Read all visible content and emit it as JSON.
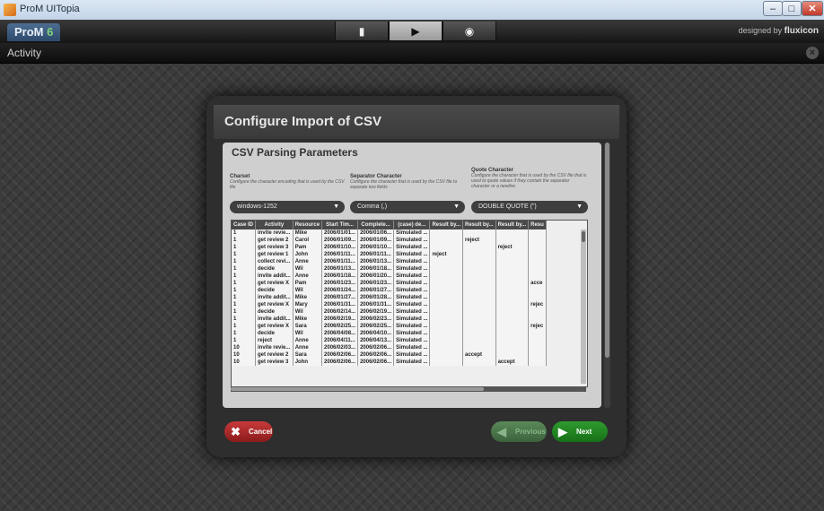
{
  "window": {
    "title": "ProM UITopia"
  },
  "header": {
    "logo_text": "ProM",
    "logo_version": "6",
    "tabs": [
      {
        "icon": "workspace-icon",
        "glyph": "▮"
      },
      {
        "icon": "play-icon",
        "glyph": "▶"
      },
      {
        "icon": "view-icon",
        "glyph": "◉"
      }
    ],
    "brand_prefix": "designed by",
    "brand_name": "fluxicon"
  },
  "activity": {
    "title": "Activity"
  },
  "dialog": {
    "title": "Configure Import of CSV",
    "section_title": "CSV Parsing Parameters",
    "params": {
      "charset": {
        "label": "Charset",
        "description": "Configure the character encoding that is used by the CSV file",
        "value": "windows-1252"
      },
      "separator": {
        "label": "Separator Character",
        "description": "Configure the character that is used by the CSV file to separate two fields",
        "value": "Comma (,)"
      },
      "quote": {
        "label": "Quote Character",
        "description": "Configure the character that is used by the CSV file that is used to quote values if they contain the separator character or a newline",
        "value": "DOUBLE QUOTE (\")"
      }
    },
    "table": {
      "columns": [
        "Case ID",
        "Activity",
        "Resource",
        "Start Tim...",
        "Complete...",
        "(case) de...",
        "Result by...",
        "Result by...",
        "Result by...",
        "Resu"
      ],
      "rows": [
        [
          "1",
          "invite revie...",
          "Mike",
          "2006/01/01...",
          "2006/01/06...",
          "Simulated ...",
          "",
          "",
          "",
          ""
        ],
        [
          "1",
          "get review 2",
          "Carol",
          "2006/01/09...",
          "2006/01/09...",
          "Simulated ...",
          "",
          "reject",
          "",
          ""
        ],
        [
          "1",
          "get review 3",
          "Pam",
          "2006/01/10...",
          "2006/01/10...",
          "Simulated ...",
          "",
          "",
          "reject",
          ""
        ],
        [
          "1",
          "get review 1",
          "John",
          "2006/01/11...",
          "2006/01/11...",
          "Simulated ...",
          "reject",
          "",
          "",
          ""
        ],
        [
          "1",
          "collect revi...",
          "Anne",
          "2006/01/11...",
          "2006/01/13...",
          "Simulated ...",
          "",
          "",
          "",
          ""
        ],
        [
          "1",
          "decide",
          "Wil",
          "2006/01/13...",
          "2006/01/18...",
          "Simulated ...",
          "",
          "",
          "",
          ""
        ],
        [
          "1",
          "invite addit...",
          "Anne",
          "2006/01/18...",
          "2006/01/20...",
          "Simulated ...",
          "",
          "",
          "",
          ""
        ],
        [
          "1",
          "get review X",
          "Pam",
          "2006/01/23...",
          "2006/01/23...",
          "Simulated ...",
          "",
          "",
          "",
          "acce"
        ],
        [
          "1",
          "decide",
          "Wil",
          "2006/01/24...",
          "2006/01/27...",
          "Simulated ...",
          "",
          "",
          "",
          ""
        ],
        [
          "1",
          "invite addit...",
          "Mike",
          "2006/01/27...",
          "2006/01/28...",
          "Simulated ...",
          "",
          "",
          "",
          ""
        ],
        [
          "1",
          "get review X",
          "Mary",
          "2006/01/31...",
          "2006/01/31...",
          "Simulated ...",
          "",
          "",
          "",
          "rejec"
        ],
        [
          "1",
          "decide",
          "Wil",
          "2006/02/14...",
          "2006/02/19...",
          "Simulated ...",
          "",
          "",
          "",
          ""
        ],
        [
          "1",
          "invite addit...",
          "Mike",
          "2006/02/19...",
          "2006/02/23...",
          "Simulated ...",
          "",
          "",
          "",
          ""
        ],
        [
          "1",
          "get review X",
          "Sara",
          "2006/02/25...",
          "2006/02/25...",
          "Simulated ...",
          "",
          "",
          "",
          "rejec"
        ],
        [
          "1",
          "decide",
          "Wil",
          "2006/04/08...",
          "2006/04/10...",
          "Simulated ...",
          "",
          "",
          "",
          ""
        ],
        [
          "1",
          "reject",
          "Anne",
          "2006/04/11...",
          "2006/04/13...",
          "Simulated ...",
          "",
          "",
          "",
          ""
        ],
        [
          "10",
          "invite revie...",
          "Anne",
          "2006/02/03...",
          "2006/02/06...",
          "Simulated ...",
          "",
          "",
          "",
          ""
        ],
        [
          "10",
          "get review 2",
          "Sara",
          "2006/02/06...",
          "2006/02/06...",
          "Simulated ...",
          "",
          "accept",
          "",
          ""
        ],
        [
          "10",
          "get review 3",
          "John",
          "2006/02/06...",
          "2006/02/06...",
          "Simulated ...",
          "",
          "",
          "accept",
          ""
        ]
      ]
    },
    "buttons": {
      "cancel": "Cancel",
      "previous": "Previous",
      "next": "Next"
    }
  }
}
